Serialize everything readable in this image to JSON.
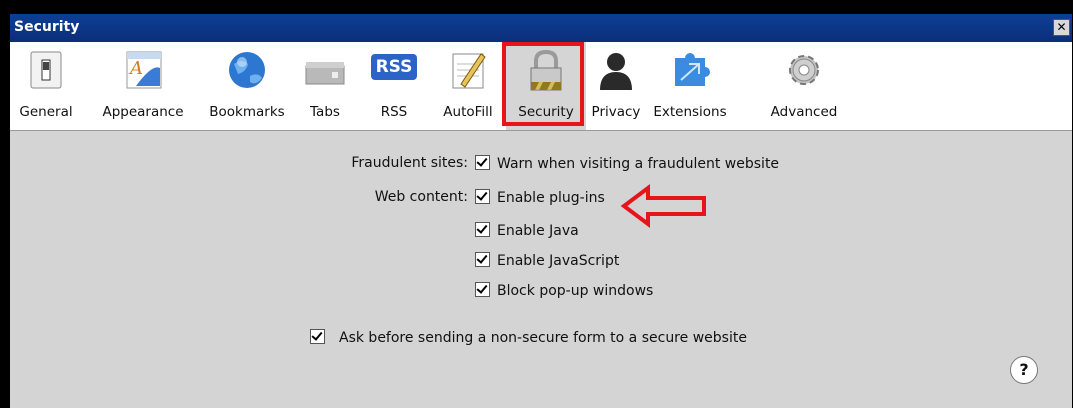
{
  "window": {
    "title": "Security",
    "close_glyph": "✕"
  },
  "toolbar": {
    "tabs": [
      {
        "label": "General",
        "icon": "switch-icon"
      },
      {
        "label": "Appearance",
        "icon": "font-icon"
      },
      {
        "label": "Bookmarks",
        "icon": "globe-icon"
      },
      {
        "label": "Tabs",
        "icon": "tabs-icon"
      },
      {
        "label": "RSS",
        "icon": "rss-icon"
      },
      {
        "label": "AutoFill",
        "icon": "pencil-icon"
      },
      {
        "label": "Security",
        "icon": "lock-icon",
        "selected": true
      },
      {
        "label": "Privacy",
        "icon": "person-icon"
      },
      {
        "label": "Extensions",
        "icon": "puzzle-icon"
      },
      {
        "label": "Advanced",
        "icon": "gear-icon"
      }
    ],
    "rss_badge": "RSS"
  },
  "security": {
    "fraudulent_label": "Fraudulent sites:",
    "fraudulent_option": "Warn when visiting a fraudulent website",
    "web_content_label": "Web content:",
    "web_content_options": [
      "Enable plug-ins",
      "Enable Java",
      "Enable JavaScript",
      "Block pop-up windows"
    ],
    "nonsecure_option": "Ask before sending a non-secure form to a secure website"
  },
  "help": "?",
  "colors": {
    "annotation_red": "#e8141c",
    "titlebar": "#0d3f96"
  }
}
